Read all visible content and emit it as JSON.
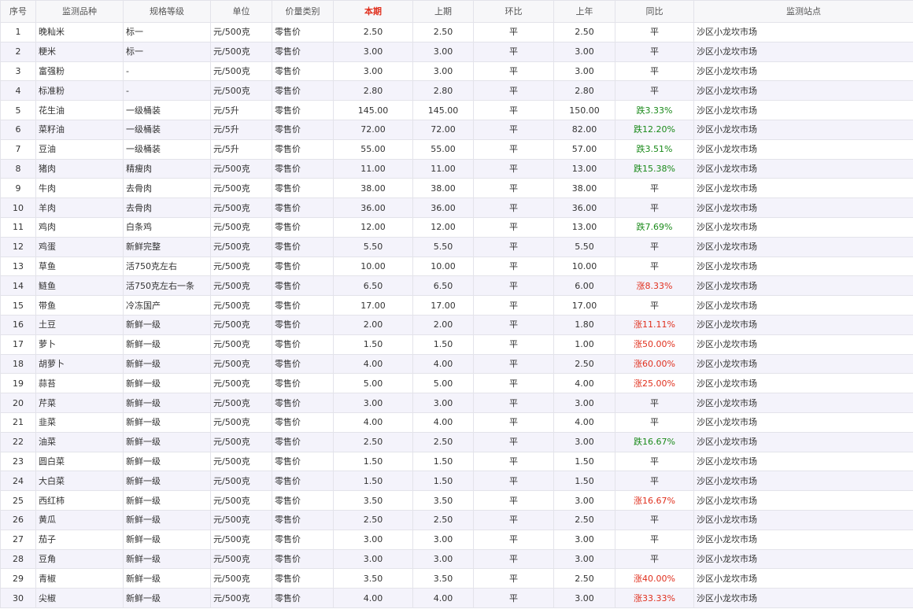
{
  "table": {
    "headers": [
      "序号",
      "监测品种",
      "规格等级",
      "单位",
      "价量类别",
      "本期",
      "上期",
      "环比",
      "上年",
      "同比",
      "监测站点"
    ],
    "highlight_header": "本期",
    "colors": {
      "highlight": "#e0301e",
      "down": "#1a8a1a",
      "up": "#e0301e",
      "row_alt": "#f4f3fb"
    },
    "rows": [
      [
        "1",
        "晚籼米",
        "标一",
        "元/500克",
        "零售价",
        "2.50",
        "2.50",
        "平",
        "2.50",
        "平",
        "沙区小龙坎市场"
      ],
      [
        "2",
        "粳米",
        "标一",
        "元/500克",
        "零售价",
        "3.00",
        "3.00",
        "平",
        "3.00",
        "平",
        "沙区小龙坎市场"
      ],
      [
        "3",
        "富强粉",
        "-",
        "元/500克",
        "零售价",
        "3.00",
        "3.00",
        "平",
        "3.00",
        "平",
        "沙区小龙坎市场"
      ],
      [
        "4",
        "标准粉",
        "-",
        "元/500克",
        "零售价",
        "2.80",
        "2.80",
        "平",
        "2.80",
        "平",
        "沙区小龙坎市场"
      ],
      [
        "5",
        "花生油",
        "一级桶装",
        "元/5升",
        "零售价",
        "145.00",
        "145.00",
        "平",
        "150.00",
        "跌3.33%",
        "沙区小龙坎市场"
      ],
      [
        "6",
        "菜籽油",
        "一级桶装",
        "元/5升",
        "零售价",
        "72.00",
        "72.00",
        "平",
        "82.00",
        "跌12.20%",
        "沙区小龙坎市场"
      ],
      [
        "7",
        "豆油",
        "一级桶装",
        "元/5升",
        "零售价",
        "55.00",
        "55.00",
        "平",
        "57.00",
        "跌3.51%",
        "沙区小龙坎市场"
      ],
      [
        "8",
        "猪肉",
        "精瘦肉",
        "元/500克",
        "零售价",
        "11.00",
        "11.00",
        "平",
        "13.00",
        "跌15.38%",
        "沙区小龙坎市场"
      ],
      [
        "9",
        "牛肉",
        "去骨肉",
        "元/500克",
        "零售价",
        "38.00",
        "38.00",
        "平",
        "38.00",
        "平",
        "沙区小龙坎市场"
      ],
      [
        "10",
        "羊肉",
        "去骨肉",
        "元/500克",
        "零售价",
        "36.00",
        "36.00",
        "平",
        "36.00",
        "平",
        "沙区小龙坎市场"
      ],
      [
        "11",
        "鸡肉",
        "白条鸡",
        "元/500克",
        "零售价",
        "12.00",
        "12.00",
        "平",
        "13.00",
        "跌7.69%",
        "沙区小龙坎市场"
      ],
      [
        "12",
        "鸡蛋",
        "新鲜完整",
        "元/500克",
        "零售价",
        "5.50",
        "5.50",
        "平",
        "5.50",
        "平",
        "沙区小龙坎市场"
      ],
      [
        "13",
        "草鱼",
        "活750克左右",
        "元/500克",
        "零售价",
        "10.00",
        "10.00",
        "平",
        "10.00",
        "平",
        "沙区小龙坎市场"
      ],
      [
        "14",
        "鲢鱼",
        "活750克左右一条",
        "元/500克",
        "零售价",
        "6.50",
        "6.50",
        "平",
        "6.00",
        "涨8.33%",
        "沙区小龙坎市场"
      ],
      [
        "15",
        "带鱼",
        "冷冻国产",
        "元/500克",
        "零售价",
        "17.00",
        "17.00",
        "平",
        "17.00",
        "平",
        "沙区小龙坎市场"
      ],
      [
        "16",
        "土豆",
        "新鲜一级",
        "元/500克",
        "零售价",
        "2.00",
        "2.00",
        "平",
        "1.80",
        "涨11.11%",
        "沙区小龙坎市场"
      ],
      [
        "17",
        "萝卜",
        "新鲜一级",
        "元/500克",
        "零售价",
        "1.50",
        "1.50",
        "平",
        "1.00",
        "涨50.00%",
        "沙区小龙坎市场"
      ],
      [
        "18",
        "胡萝卜",
        "新鲜一级",
        "元/500克",
        "零售价",
        "4.00",
        "4.00",
        "平",
        "2.50",
        "涨60.00%",
        "沙区小龙坎市场"
      ],
      [
        "19",
        "蒜苔",
        "新鲜一级",
        "元/500克",
        "零售价",
        "5.00",
        "5.00",
        "平",
        "4.00",
        "涨25.00%",
        "沙区小龙坎市场"
      ],
      [
        "20",
        "芹菜",
        "新鲜一级",
        "元/500克",
        "零售价",
        "3.00",
        "3.00",
        "平",
        "3.00",
        "平",
        "沙区小龙坎市场"
      ],
      [
        "21",
        "韭菜",
        "新鲜一级",
        "元/500克",
        "零售价",
        "4.00",
        "4.00",
        "平",
        "4.00",
        "平",
        "沙区小龙坎市场"
      ],
      [
        "22",
        "油菜",
        "新鲜一级",
        "元/500克",
        "零售价",
        "2.50",
        "2.50",
        "平",
        "3.00",
        "跌16.67%",
        "沙区小龙坎市场"
      ],
      [
        "23",
        "圆白菜",
        "新鲜一级",
        "元/500克",
        "零售价",
        "1.50",
        "1.50",
        "平",
        "1.50",
        "平",
        "沙区小龙坎市场"
      ],
      [
        "24",
        "大白菜",
        "新鲜一级",
        "元/500克",
        "零售价",
        "1.50",
        "1.50",
        "平",
        "1.50",
        "平",
        "沙区小龙坎市场"
      ],
      [
        "25",
        "西红柿",
        "新鲜一级",
        "元/500克",
        "零售价",
        "3.50",
        "3.50",
        "平",
        "3.00",
        "涨16.67%",
        "沙区小龙坎市场"
      ],
      [
        "26",
        "黄瓜",
        "新鲜一级",
        "元/500克",
        "零售价",
        "2.50",
        "2.50",
        "平",
        "2.50",
        "平",
        "沙区小龙坎市场"
      ],
      [
        "27",
        "茄子",
        "新鲜一级",
        "元/500克",
        "零售价",
        "3.00",
        "3.00",
        "平",
        "3.00",
        "平",
        "沙区小龙坎市场"
      ],
      [
        "28",
        "豆角",
        "新鲜一级",
        "元/500克",
        "零售价",
        "3.00",
        "3.00",
        "平",
        "3.00",
        "平",
        "沙区小龙坎市场"
      ],
      [
        "29",
        "青椒",
        "新鲜一级",
        "元/500克",
        "零售价",
        "3.50",
        "3.50",
        "平",
        "2.50",
        "涨40.00%",
        "沙区小龙坎市场"
      ],
      [
        "30",
        "尖椒",
        "新鲜一级",
        "元/500克",
        "零售价",
        "4.00",
        "4.00",
        "平",
        "3.00",
        "涨33.33%",
        "沙区小龙坎市场"
      ]
    ]
  }
}
